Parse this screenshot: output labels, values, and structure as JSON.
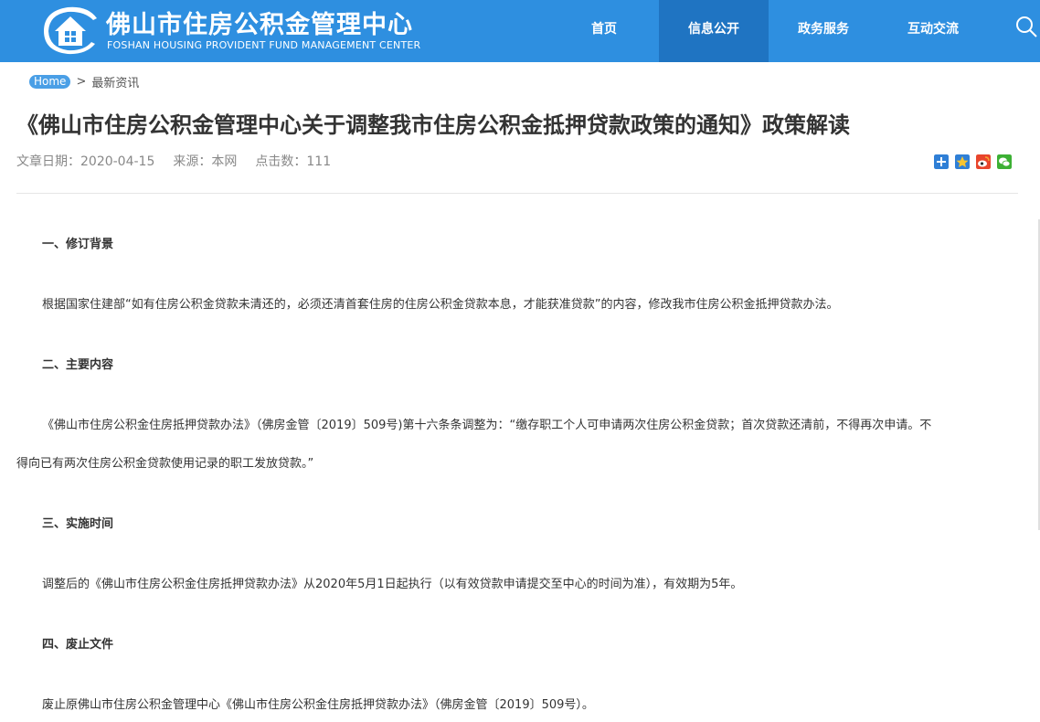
{
  "header": {
    "title_cn": "佛山市住房公积金管理中心",
    "title_en": "FOSHAN HOUSING PROVIDENT FUND MANAGEMENT CENTER",
    "nav": [
      "首页",
      "信息公开",
      "政务服务",
      "互动交流"
    ],
    "active_nav": "信息公开",
    "search_icon": "search-icon"
  },
  "breadcrumb": {
    "home": "Home",
    "separator": ">",
    "current": "最新资讯"
  },
  "article": {
    "title": "《佛山市住房公积金管理中心关于调整我市住房公积金抵押贷款政策的通知》政策解读",
    "meta": {
      "date": "文章日期：2020-04-15",
      "source": "来源：本网",
      "views": "点击数：111"
    },
    "share_icons": [
      "share-plus-icon",
      "qzone-icon",
      "weibo-icon",
      "wechat-icon"
    ],
    "sections": [
      {
        "heading": "一、修订背景",
        "body": "根据国家住建部“如有住房公积金贷款未清还的，必须还清首套住房的住房公积金贷款本息，才能获准贷款”的内容，修改我市住房公积金抵押贷款办法。"
      },
      {
        "heading": "二、主要内容",
        "body_line1": "《佛山市住房公积金住房抵押贷款办法》（佛房金管〔2019〕509号)第十六条条调整为：“缴存职工个人可申请两次住房公积金贷款；首次贷款还清前，不得再次申请。不",
        "body_line2": "得向已有两次住房公积金贷款使用记录的职工发放贷款。”"
      },
      {
        "heading": "三、实施时间",
        "body": "调整后的《佛山市住房公积金住房抵押贷款办法》从2020年5月1日起执行（以有效贷款申请提交至中心的时间为准），有效期为5年。"
      },
      {
        "heading": "四、废止文件",
        "body": "废止原佛山市住房公积金管理中心《佛山市住房公积金住房抵押贷款办法》（佛房金管〔2019〕509号）。"
      }
    ]
  },
  "colors": {
    "header_bg": "#2e8fe0",
    "nav_active_bg": "#1f74c2",
    "home_pill": "#4a9fe6"
  }
}
